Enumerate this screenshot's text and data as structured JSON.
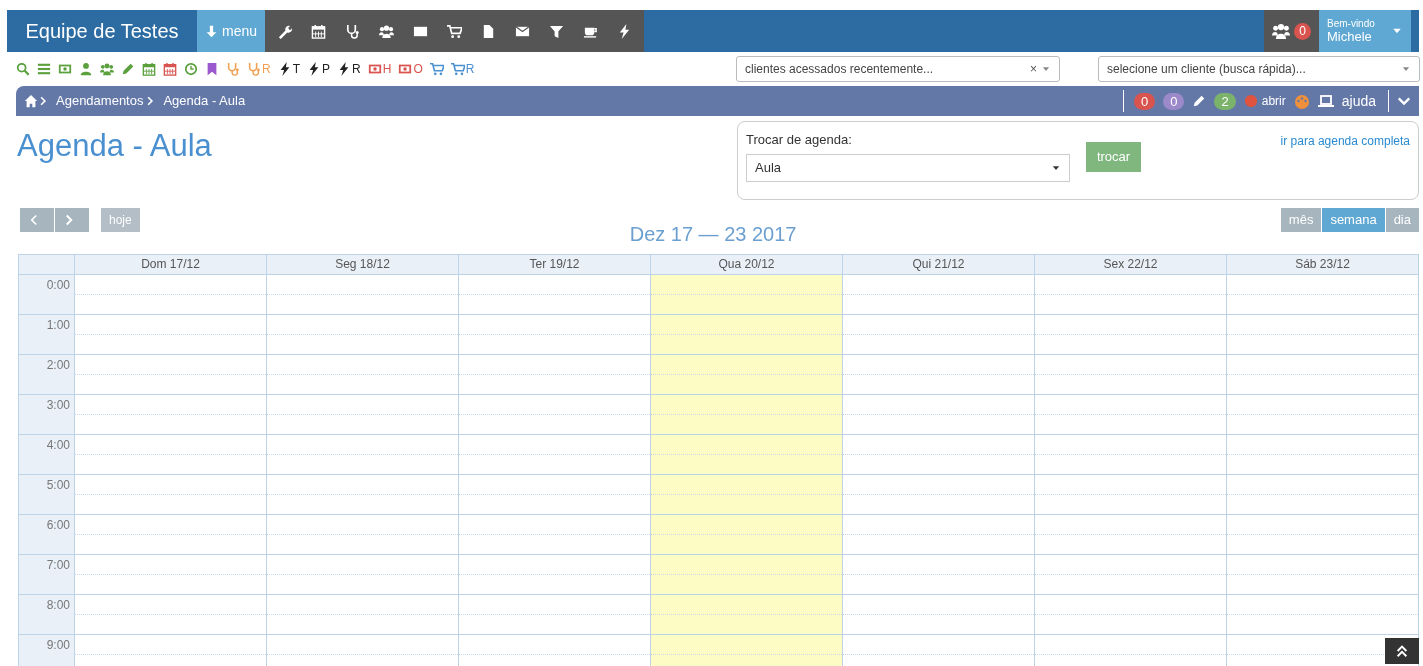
{
  "navbar": {
    "brand": "Equipe de Testes",
    "menu_label": "menu",
    "users_badge": "0",
    "welcome": "Bem-vindo",
    "user": "Michele"
  },
  "quick_links": [
    {
      "color": "#5aa03c"
    },
    {
      "color": "#5aa03c"
    },
    {
      "color": "#5aa03c"
    },
    {
      "color": "#5aa03c"
    },
    {
      "color": "#5aa03c"
    },
    {
      "color": "#5aa03c"
    },
    {
      "color": "#5aa03c"
    },
    {
      "color": "#d9534f"
    },
    {
      "color": "#5aa03c"
    },
    {
      "color": "#9b59d0"
    },
    {
      "color": "#f0a050"
    },
    {
      "color": "#f0a050",
      "suffix": "R"
    },
    {
      "color": "#222222",
      "suffix": "T"
    },
    {
      "color": "#222222",
      "suffix": "P"
    },
    {
      "color": "#222222",
      "suffix": "R"
    },
    {
      "color": "#d9534f",
      "suffix": "H"
    },
    {
      "color": "#d9534f",
      "suffix": "O"
    },
    {
      "color": "#4a90d0"
    },
    {
      "color": "#4a90d0",
      "suffix": "R"
    }
  ],
  "recent_clients": {
    "placeholder": "clientes acessados recentemente...",
    "clear": "×"
  },
  "client_search": {
    "placeholder": "selecione um cliente (busca rápida)..."
  },
  "breadcrumb": [
    "Agendamentos",
    "Agenda - Aula"
  ],
  "status_badges": [
    {
      "text": "0",
      "color": "#d9534f"
    },
    {
      "text": "0",
      "color": "#9b89c9"
    },
    {
      "text": "2",
      "color": "#7cb36a"
    }
  ],
  "open_label": "abrir",
  "help_label": "ajuda",
  "page_title": "Agenda - Aula",
  "switcher": {
    "label": "Trocar de agenda:",
    "value": "Aula",
    "button": "trocar",
    "link": "ir para agenda completa"
  },
  "calendar": {
    "title": "Dez 17 — 23 2017",
    "today_button": {
      "label": "hoje",
      "disabled": true
    },
    "views": [
      {
        "label": "mês",
        "selected": false
      },
      {
        "label": "semana",
        "selected": true
      },
      {
        "label": "dia",
        "selected": false
      }
    ],
    "days": [
      {
        "label": "Dom 17/12",
        "today": false
      },
      {
        "label": "Seg 18/12",
        "today": false
      },
      {
        "label": "Ter 19/12",
        "today": false
      },
      {
        "label": "Qua 20/12",
        "today": true
      },
      {
        "label": "Qui 21/12",
        "today": false
      },
      {
        "label": "Sex 22/12",
        "today": false
      },
      {
        "label": "Sáb 23/12",
        "today": false
      }
    ],
    "hours": [
      "0:00",
      "1:00",
      "2:00",
      "3:00",
      "4:00",
      "5:00",
      "6:00",
      "7:00",
      "8:00",
      "9:00"
    ]
  }
}
